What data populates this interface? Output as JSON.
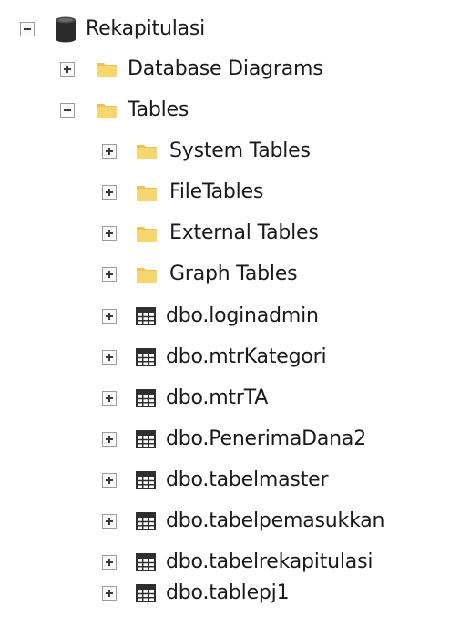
{
  "tree": {
    "root": {
      "label": "Rekapitulasi",
      "icon": "database-icon",
      "expanded": true
    },
    "database_diagrams": {
      "label": "Database Diagrams",
      "icon": "folder-icon",
      "expanded": false
    },
    "tables": {
      "label": "Tables",
      "icon": "folder-icon",
      "expanded": true,
      "folders": [
        {
          "label": "System Tables",
          "icon": "folder-icon",
          "expanded": false
        },
        {
          "label": "FileTables",
          "icon": "folder-icon",
          "expanded": false
        },
        {
          "label": "External Tables",
          "icon": "folder-icon",
          "expanded": false
        },
        {
          "label": "Graph Tables",
          "icon": "folder-icon",
          "expanded": false
        }
      ],
      "items": [
        {
          "label": "dbo.loginadmin",
          "icon": "table-icon",
          "expanded": false
        },
        {
          "label": "dbo.mtrKategori",
          "icon": "table-icon",
          "expanded": false
        },
        {
          "label": "dbo.mtrTA",
          "icon": "table-icon",
          "expanded": false
        },
        {
          "label": "dbo.PenerimaDana2",
          "icon": "table-icon",
          "expanded": false
        },
        {
          "label": "dbo.tabelmaster",
          "icon": "table-icon",
          "expanded": false
        },
        {
          "label": "dbo.tabelpemasukkan",
          "icon": "table-icon",
          "expanded": false
        },
        {
          "label": "dbo.tabelrekapitulasi",
          "icon": "table-icon",
          "expanded": false
        },
        {
          "label": "dbo.tablepj1",
          "icon": "table-icon",
          "expanded": false
        }
      ]
    }
  },
  "colors": {
    "folder": "#f5d66f",
    "folder_tab": "#e9c355",
    "database": "#2b2b2b",
    "table_grid": "#2f2f2f",
    "expander_border": "#9c9c9c"
  }
}
